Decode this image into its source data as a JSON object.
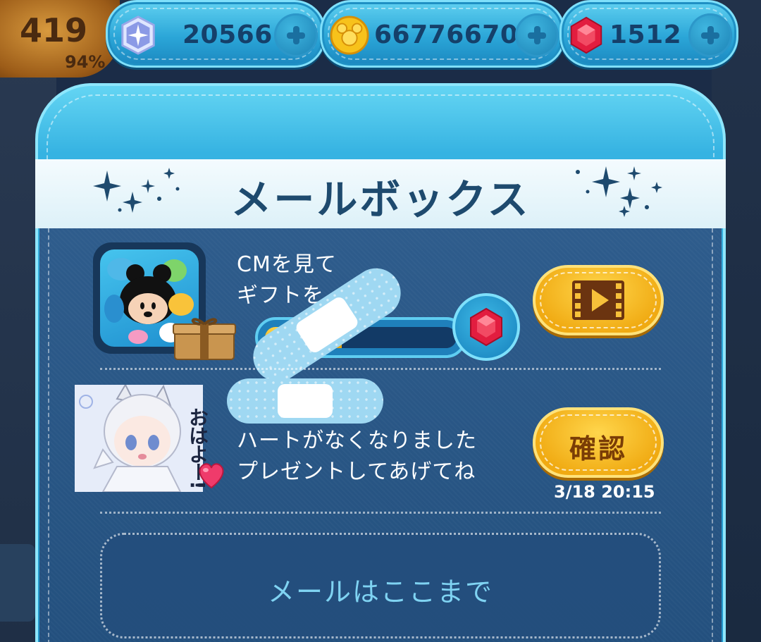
{
  "player": {
    "level": "419",
    "level_progress_text": "94%",
    "level_progress": 0.94
  },
  "currencies": [
    {
      "name": "star-crystal",
      "value": "20566"
    },
    {
      "name": "coin",
      "value": "66776670"
    },
    {
      "name": "ruby",
      "value": "1512"
    }
  ],
  "mailbox": {
    "title": "メールボックス",
    "end_text": "メールはここまで"
  },
  "mails": [
    {
      "line1": "CMを見て",
      "line2": "ギフトを...!",
      "progress": 0.4,
      "action_icon": "video-play-icon"
    },
    {
      "line1": "ハートがなくなりました",
      "line2": "プレゼントしてあげてね",
      "action_label": "確認",
      "timestamp": "3/18 20:15",
      "avatar_text": "おはよー!"
    }
  ],
  "colors": {
    "panel": "#36b3e2",
    "content": "#2a5888",
    "button": "#f5b81c",
    "title": "#1e4a6e"
  }
}
